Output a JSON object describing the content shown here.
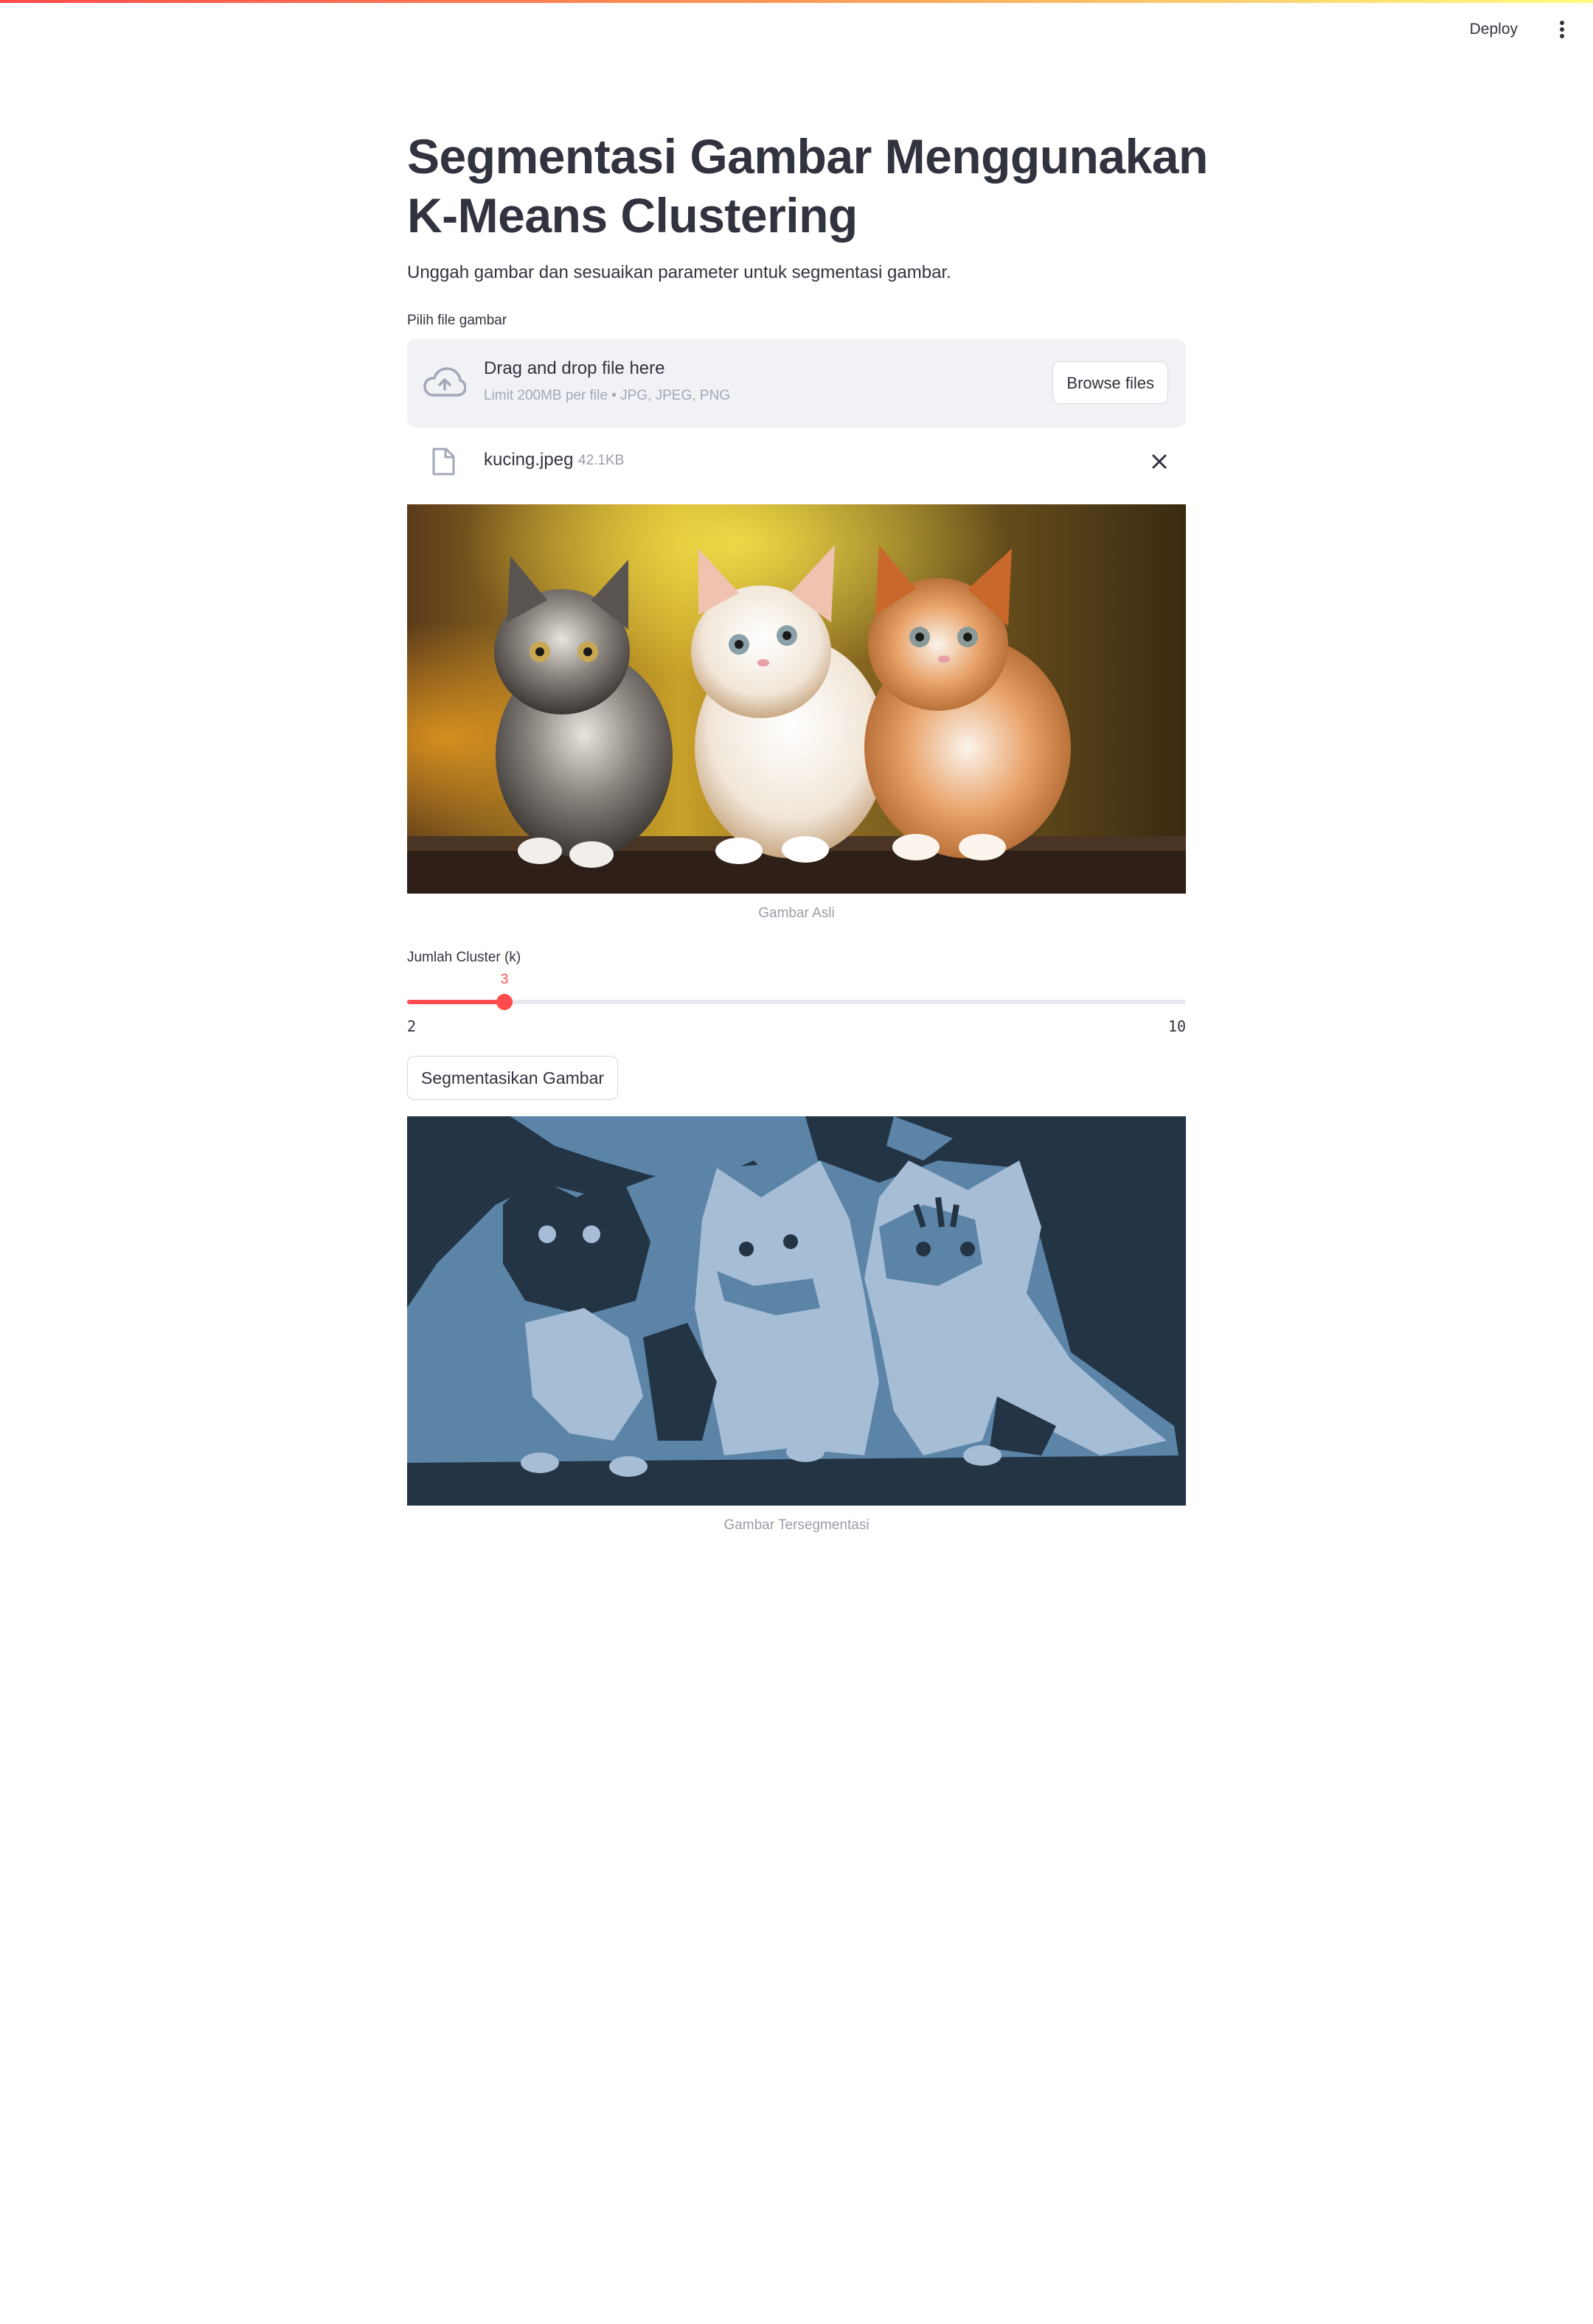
{
  "header": {
    "deploy_label": "Deploy",
    "menu_icon": "more-vertical-icon"
  },
  "main": {
    "title_line1": "Segmentasi Gambar Menggunakan",
    "title_line2": "K-Means Clustering",
    "subtitle": "Unggah gambar dan sesuaikan parameter untuk segmentasi gambar."
  },
  "uploader": {
    "label": "Pilih file gambar",
    "drop_text": "Drag and drop file here",
    "hint": "Limit 200MB per file • JPG, JPEG, PNG",
    "browse_label": "Browse files",
    "upload_icon": "cloud-upload-icon",
    "file": {
      "name": "kucing.jpeg",
      "size": "42.1KB",
      "icon": "file-icon",
      "remove_icon": "close-icon"
    }
  },
  "original_image": {
    "caption": "Gambar Asli"
  },
  "slider": {
    "label": "Jumlah Cluster (k)",
    "value": 3,
    "value_text": "3",
    "min": 2,
    "max": 10,
    "min_text": "2",
    "max_text": "10"
  },
  "segment_button": {
    "label": "Segmentasikan Gambar"
  },
  "segmented_image": {
    "caption": "Gambar Tersegmentasi",
    "palette": [
      "#233445",
      "#5b84a7",
      "#a6bdd6"
    ]
  },
  "colors": {
    "primary": "#ff4b4b",
    "text": "#31333f",
    "dropzone_bg": "#f0f2f6"
  }
}
